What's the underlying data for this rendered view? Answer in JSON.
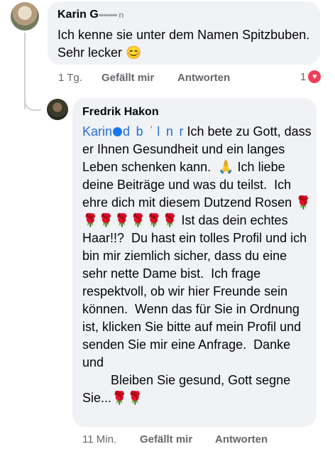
{
  "comment1": {
    "author": "Karin G",
    "author_blur": "▪▪▪▪▪▪▪▪ n",
    "text": "Ich kenne sie unter dem Namen Spitzbuben. Sehr lecker 😊",
    "time": "1 Tg.",
    "like_label": "Gefällt mir",
    "reply_label": "Antworten",
    "reaction_count": "1",
    "reaction_icon": "heart-icon",
    "reaction_color": "#f33e58"
  },
  "comment2": {
    "author": "Fredrik Hakon",
    "mention_start": "Karin",
    "mention_tail": "d  b  ˈ l  n  r",
    "text": "Ich bete zu Gott, dass er Ihnen Gesundheit und ein langes Leben schenken kann.  🙏 Ich liebe deine Beiträge und was du teilst.  Ich ehre dich mit diesem Dutzend Rosen 🌹🌹🌹🌹🌹🌹🌹 Ist das dein echtes Haar!!?  Du hast ein tolles Profil und ich bin mir ziemlich sicher, dass du eine sehr nette Dame bist.  Ich frage respektvoll, ob wir hier Freunde sein können.  Wenn das für Sie in Ordnung ist, klicken Sie bitte auf mein Profil und senden Sie mir eine Anfrage.  Danke und\n        Bleiben Sie gesund, Gott segne Sie...🌹🌹",
    "time": "11 Min.",
    "like_label": "Gefällt mir",
    "reply_label": "Antworten"
  },
  "colors": {
    "link": "#216fdb",
    "bubble": "#f0f2f5",
    "meta": "#65676b"
  }
}
